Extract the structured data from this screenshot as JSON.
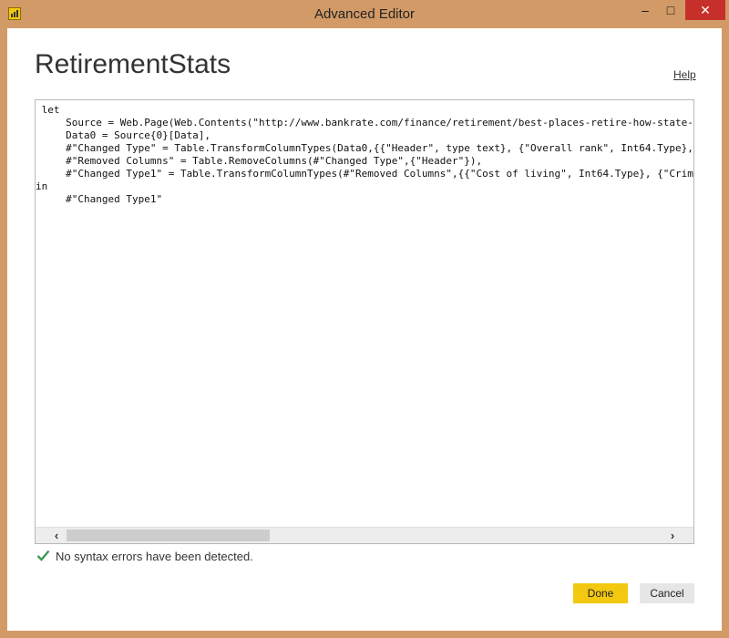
{
  "window": {
    "title": "Advanced Editor",
    "controls": {
      "minimize": "–",
      "maximize": "□",
      "close": "✕"
    }
  },
  "query": {
    "name": "RetirementStats"
  },
  "help": {
    "label": "Help"
  },
  "editor": {
    "lines": [
      " let",
      "     Source = Web.Page(Web.Contents(\"http://www.bankrate.com/finance/retirement/best-places-retire-how-state-r",
      "     Data0 = Source{0}[Data],",
      "     #\"Changed Type\" = Table.TransformColumnTypes(Data0,{{\"Header\", type text}, {\"Overall rank\", Int64.Type},",
      "     #\"Removed Columns\" = Table.RemoveColumns(#\"Changed Type\",{\"Header\"}),",
      "     #\"Changed Type1\" = Table.TransformColumnTypes(#\"Removed Columns\",{{\"Cost of living\", Int64.Type}, {\"Crime",
      "in",
      "     #\"Changed Type1\""
    ],
    "scroll": {
      "left_arrow": "‹",
      "right_arrow": "›"
    }
  },
  "status": {
    "text": "No syntax errors have been detected.",
    "color": "#3c9a56"
  },
  "buttons": {
    "done": "Done",
    "cancel": "Cancel"
  },
  "colors": {
    "accent": "#f2c811",
    "frame": "#d29a66",
    "close": "#c7302a"
  }
}
